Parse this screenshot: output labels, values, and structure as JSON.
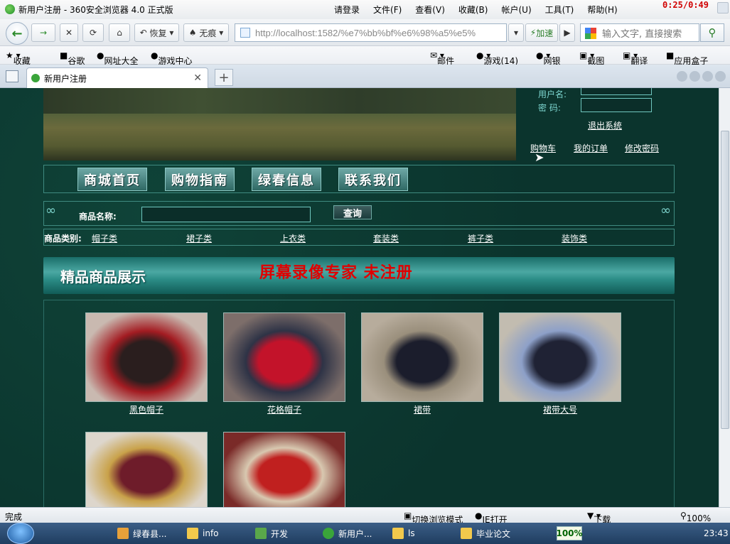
{
  "browser": {
    "title": "新用户注册 - 360安全浏览器 4.0 正式版",
    "menu": [
      "请登录",
      "文件(F)",
      "查看(V)",
      "收藏(B)",
      "帐户(U)",
      "工具(T)",
      "帮助(H)"
    ],
    "timer": "0:25/0:49",
    "nav_buttons": {
      "restore": "恢复",
      "noproxy": "无痕"
    },
    "address": "http://localhost:1582/%e7%bb%bf%e6%98%a5%e5%",
    "accelerate": "加速",
    "search_placeholder": "输入文字, 直接搜索",
    "favorites": [
      "收藏",
      "谷歌",
      "网址大全",
      "游戏中心"
    ],
    "fav_right": [
      "邮件",
      "游戏(14)",
      "网银",
      "截图",
      "翻译",
      "应用盒子"
    ],
    "tab_title": "新用户注册"
  },
  "page": {
    "login": {
      "user_label": "用户名:",
      "pwd_label": "密  码:",
      "logout": "退出系统"
    },
    "top_links": [
      "购物车",
      "我的订单",
      "修改密码"
    ],
    "nav": [
      "商城首页",
      "购物指南",
      "绿春信息",
      "联系我们"
    ],
    "search": {
      "label": "商品名称:",
      "button": "查询"
    },
    "categories": {
      "label": "商品类别:",
      "items": [
        "帽子类",
        "裙子类",
        "上衣类",
        "套装类",
        "裤子类",
        "装饰类"
      ]
    },
    "showcase_title": "精品商品展示",
    "watermark": "屏幕录像专家 未注册",
    "products": [
      {
        "name": "黑色帽子",
        "colors": [
          "#c9b9b0",
          "#2a1e1e",
          "#a31c22"
        ]
      },
      {
        "name": "花格帽子",
        "colors": [
          "#7d6e6a",
          "#c3132a",
          "#2e3346"
        ]
      },
      {
        "name": "裙带",
        "colors": [
          "#b7ac9c",
          "#1b1d2c",
          "#9a8f7c"
        ]
      },
      {
        "name": "裙带大号",
        "colors": [
          "#c2bcb0",
          "#1f2234",
          "#8da0c8"
        ]
      },
      {
        "name": "",
        "colors": [
          "#ddd6cc",
          "#6e1c2a",
          "#c9a24a"
        ]
      },
      {
        "name": "",
        "colors": [
          "#7a2a28",
          "#c0201f",
          "#d8c8b0"
        ]
      }
    ]
  },
  "status": {
    "left": "完成",
    "switch_mode": "切换浏览模式",
    "ie_open": "IE打开",
    "download": "下载",
    "zoom": "100%"
  },
  "taskbar": {
    "items": [
      "绿春县...",
      "info",
      "开发",
      "新用户...",
      "ls",
      "毕业论文"
    ],
    "percent": "100%",
    "clock": "23:43"
  }
}
